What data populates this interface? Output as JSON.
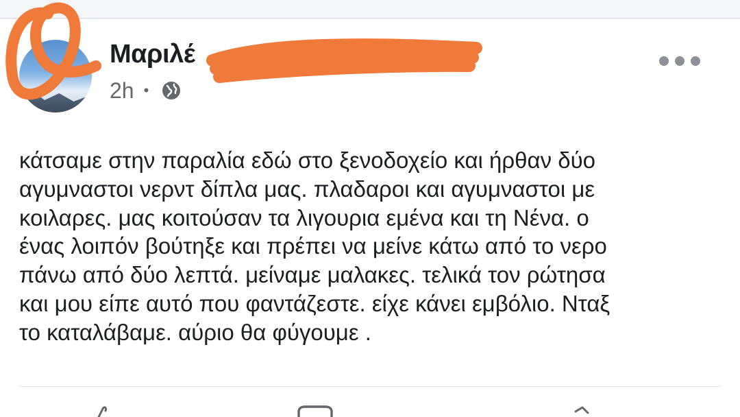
{
  "post": {
    "author_name": "Μαριλέ",
    "timestamp": "2h",
    "separator": "•",
    "privacy_icon": "globe-icon",
    "more_icon": "more-horizontal-icon",
    "body_lines": [
      "κάτσαμε στην παραλία εδώ στο ξενοδοχείο και ήρθαν δύο",
      "αγυμναστοι νερντ δίπλα μας. πλαδαροι και αγυμναστοι με",
      "κοιλαρες. μας κοιτούσαν τα λιγουρια εμένα και τη Νένα. ο",
      "ένας λοιπόν βούτηξε και πρέπει να μείνε κάτω από το νερο",
      "πάνω από δύο λεπτά. μείναμε μαλακες. τελικά τον ρώτησα",
      "και μου είπε αυτό που φαντάζεστε. είχε κάνει εμβόλιο. Νταξ",
      "το καταλάβαμε. αύριο θα φύγουμε ."
    ]
  },
  "actions": {
    "icons": [
      "like-icon",
      "comment-icon",
      "share-icon"
    ]
  },
  "colors": {
    "redaction": "#f07a3a",
    "text": "#1c1e21",
    "secondary_text": "#65676b"
  }
}
